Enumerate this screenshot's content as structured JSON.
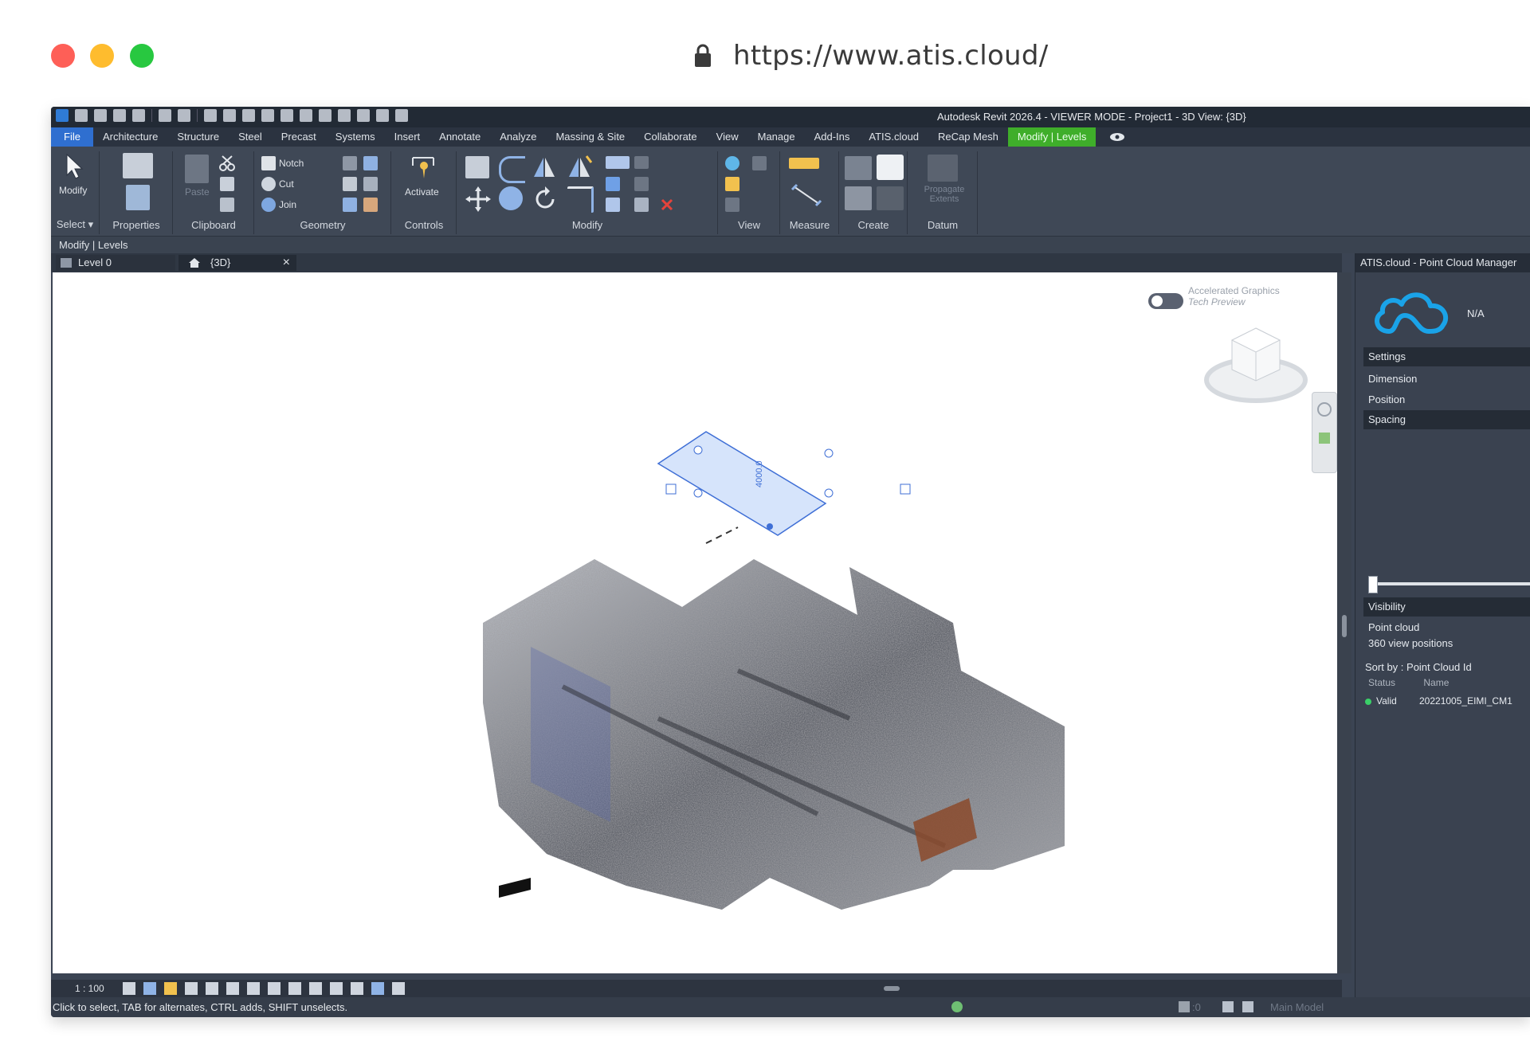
{
  "browser": {
    "url": "https://www.atis.cloud/"
  },
  "app": {
    "title": "Autodesk Revit 2026.4 - VIEWER MODE - Project1 - 3D View: {3D}",
    "menu_tabs": [
      "File",
      "Architecture",
      "Structure",
      "Steel",
      "Precast",
      "Systems",
      "Insert",
      "Annotate",
      "Analyze",
      "Massing & Site",
      "Collaborate",
      "View",
      "Manage",
      "Add-Ins",
      "ATIS.cloud",
      "ReCap Mesh",
      "Modify | Levels"
    ],
    "active_tab": "Modify | Levels",
    "ribbon": {
      "groups": [
        "Select",
        "Properties",
        "Clipboard",
        "Geometry",
        "Controls",
        "Modify",
        "View",
        "Measure",
        "Create",
        "Datum"
      ],
      "labels": {
        "modify": "Modify",
        "notch": "Notch",
        "cut": "Cut",
        "join": "Join",
        "activate": "Activate",
        "paste": "Paste",
        "propagate": "Propagate Extents"
      }
    },
    "context_label": "Modify | Levels",
    "view_tabs": [
      "Level 0",
      "{3D}"
    ],
    "viewport": {
      "toggle_label_line1": "Accelerated Graphics",
      "toggle_label_line2": "Tech Preview",
      "level_dimension": "4000.0"
    },
    "view_scale": "1 : 100",
    "status_message": "Click to select, TAB for alternates, CTRL adds, SHIFT unselects.",
    "status_model": "Main Model",
    "status_count": ":0",
    "colors": {
      "accent_green": "#3fae2a",
      "file_blue": "#2f6fd0",
      "brand_cyan": "#1aa3e8"
    }
  },
  "panel": {
    "title": "ATIS.cloud - Point Cloud Manager",
    "na": "N/A",
    "sections": {
      "settings": "Settings",
      "dimension": "Dimension",
      "position": "Position",
      "spacing": "Spacing",
      "visibility": "Visibility",
      "point_cloud": "Point cloud",
      "view_positions": "360 view positions"
    },
    "sort_by": "Sort by : Point Cloud Id",
    "columns": [
      "Status",
      "Name"
    ],
    "rows": [
      {
        "status": "Valid",
        "name": "20221005_EIMI_CM1"
      }
    ]
  }
}
